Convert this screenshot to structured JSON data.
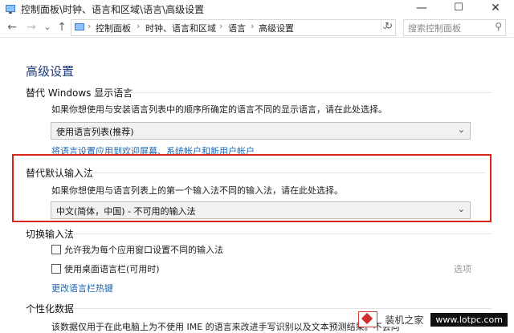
{
  "window": {
    "title": "控制面板\\时钟、语言和区域\\语言\\高级设置",
    "minimize": "—",
    "maximize": "☐",
    "close": "✕"
  },
  "nav": {
    "back": "←",
    "forward": "→",
    "dropdown": "⌄",
    "up": "↑",
    "breadcrumb": [
      "控制面板",
      "时钟、语言和区域",
      "语言",
      "高级设置"
    ],
    "search_placeholder": "搜索控制面板"
  },
  "page": {
    "title": "高级设置",
    "display_language": {
      "heading": "替代 Windows 显示语言",
      "description": "如果你想使用与安装语言列表中的顺序所确定的语言不同的显示语言，请在此处选择。",
      "selected": "使用语言列表(推荐)",
      "link": "将语言设置应用到欢迎屏幕、系统帐户和新用户帐户"
    },
    "default_input": {
      "heading": "替代默认输入法",
      "description": "如果你想使用与语言列表上的第一个输入法不同的输入法，请在此处选择。",
      "selected": "中文(简体，中国) - 不可用的输入法"
    },
    "switch_input": {
      "heading": "切换输入法",
      "option1": "允许我为每个应用窗口设置不同的输入法",
      "option2": "使用桌面语言栏(可用时)",
      "options_link": "选项",
      "hotkeys_link": "更改语言栏热键"
    },
    "personalization": {
      "heading": "个性化数据",
      "description": "该数据仅用于在此电脑上为不使用 IME 的语言来改进手写识别以及文本预测结果。不会向"
    }
  },
  "watermark": {
    "text": "装机之家",
    "url": "www.lotpc.com"
  },
  "colors": {
    "highlight_box": "#d9261c",
    "link": "#1a66b2",
    "title": "#1f3a7a"
  }
}
